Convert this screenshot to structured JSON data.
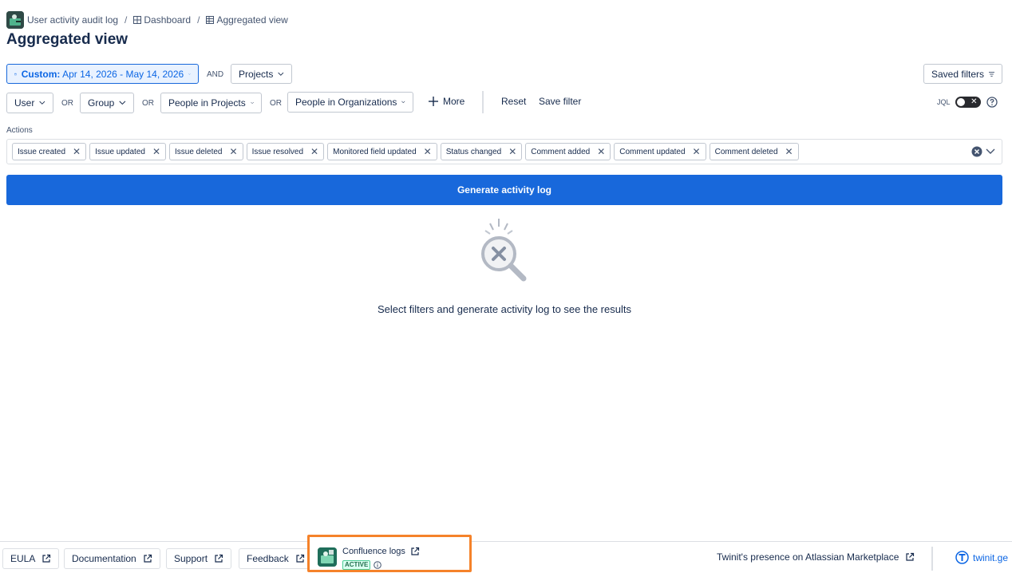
{
  "breadcrumb": {
    "items": [
      "User activity audit log",
      "Dashboard",
      "Aggregated view"
    ],
    "separator": "/"
  },
  "page_title": "Aggregated view",
  "filters": {
    "date_prefix": "Custom:",
    "date_range": "Apr 14, 2026 - May 14, 2026",
    "and_label": "AND",
    "projects_label": "Projects",
    "saved_filters_label": "Saved filters",
    "or_label": "OR",
    "user_label": "User",
    "group_label": "Group",
    "people_in_projects_label": "People in Projects",
    "people_in_orgs_label": "People in Organizations",
    "more_label": "More",
    "reset_label": "Reset",
    "save_filter_label": "Save filter",
    "jql_label": "JQL",
    "jql_enabled": false
  },
  "actions": {
    "label": "Actions",
    "selected": [
      "Issue created",
      "Issue updated",
      "Issue deleted",
      "Issue resolved",
      "Monitored field updated",
      "Status changed",
      "Comment added",
      "Comment updated",
      "Comment deleted"
    ]
  },
  "generate_label": "Generate activity log",
  "empty_state": {
    "icon": "search-error-icon",
    "message": "Select filters and generate activity log to see the results"
  },
  "footer": {
    "eula": "EULA",
    "documentation": "Documentation",
    "support": "Support",
    "feedback": "Feedback",
    "confluence_logs": "Confluence logs",
    "active_badge": "ACTIVE",
    "presence": "Twinit's presence on Atlassian Marketplace",
    "twinit": "twinit.ge"
  },
  "colors": {
    "primary": "#1868db",
    "highlight": "#f5822a",
    "active_green": "#216e4e"
  }
}
